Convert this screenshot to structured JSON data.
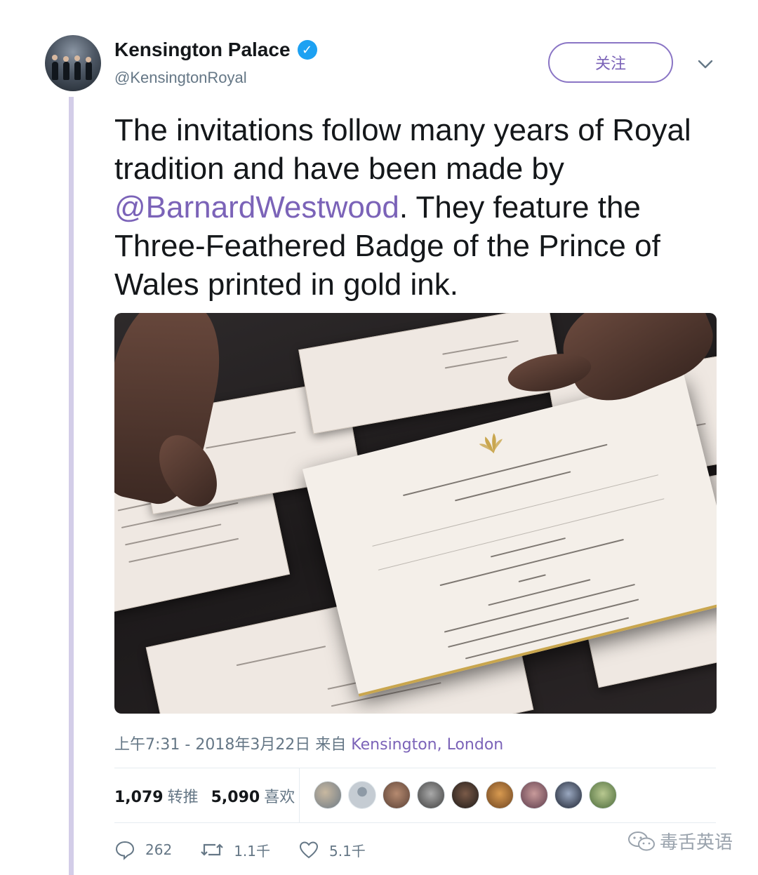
{
  "account": {
    "display_name": "Kensington Palace",
    "handle": "@KensingtonRoyal",
    "verified": true,
    "follow_label": "关注"
  },
  "tweet": {
    "text_part1": "The invitations follow many years of Royal tradition and have been made by ",
    "mention": "@BarnardWestwood",
    "text_part2": ". They feature the Three-Feathered Badge of the Prince of Wales printed in gold ink."
  },
  "meta": {
    "time_date": "上午7:31 - 2018年3月22日 来自 ",
    "location": "Kensington, London"
  },
  "stats": {
    "retweets_count": "1,079",
    "retweets_label": "转推",
    "likes_count": "5,090",
    "likes_label": "喜欢"
  },
  "actions": {
    "replies": "262",
    "retweets": "1.1千",
    "likes": "5.1千"
  },
  "watermark": "毒舌英语",
  "colors": {
    "accent": "#7b63b8",
    "verified": "#1da1f2",
    "muted_text": "#657786",
    "thread_line": "#d3cde8"
  }
}
